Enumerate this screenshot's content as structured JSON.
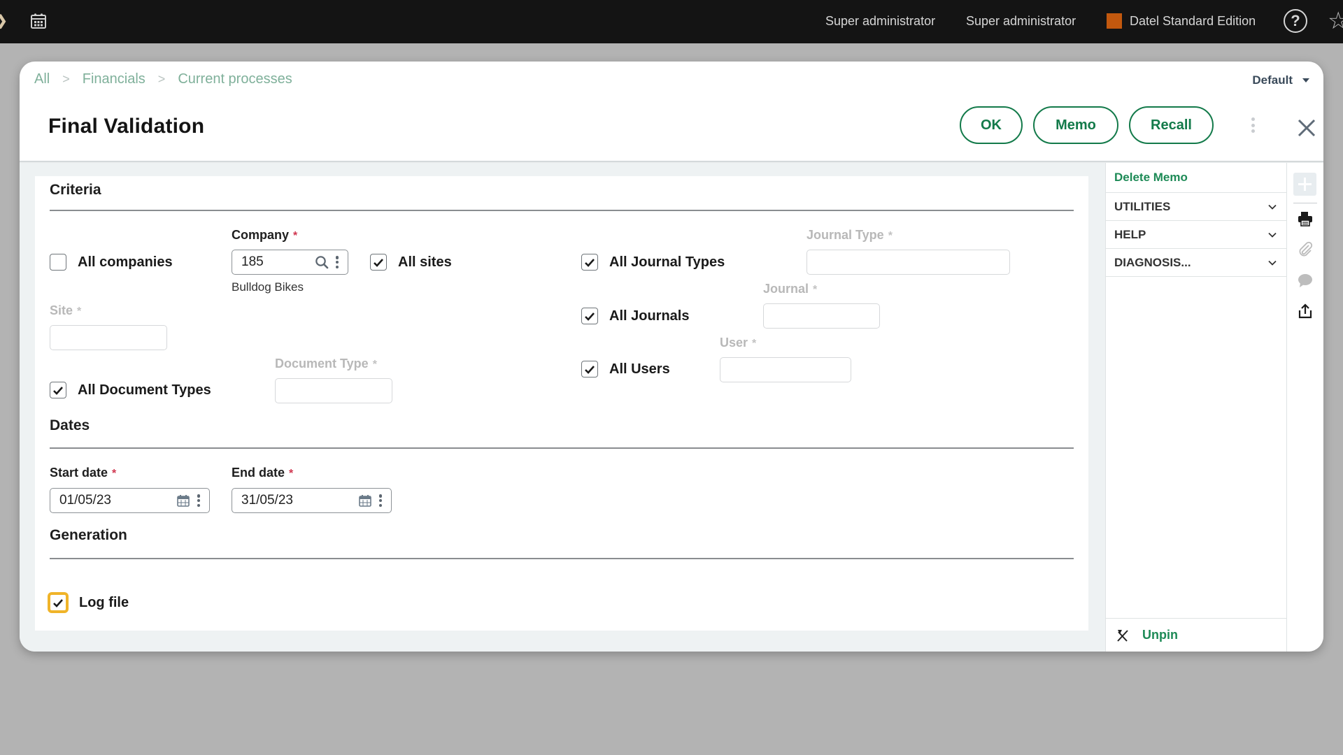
{
  "topbar": {
    "user_role": "Super administrator",
    "user_name": "Super administrator",
    "edition": "Datel Standard Edition",
    "edition_color": "#c2580e",
    "help_glyph": "?",
    "icons": [
      "menu-icon",
      "calendar-icon",
      "help-icon",
      "star-icon"
    ]
  },
  "breadcrumb": {
    "items": [
      "All",
      "Financials",
      "Current processes"
    ],
    "separator": ">"
  },
  "view_selector": {
    "label": "Default"
  },
  "page": {
    "title": "Final Validation",
    "actions": {
      "ok": "OK",
      "memo": "Memo",
      "recall": "Recall"
    }
  },
  "accent_color": "#137a4a",
  "criteria": {
    "title": "Criteria",
    "all_companies": {
      "label": "All companies",
      "checked": false
    },
    "company": {
      "label": "Company",
      "value": "185",
      "description": "Bulldog Bikes",
      "required": true
    },
    "all_sites": {
      "label": "All sites",
      "checked": true
    },
    "site": {
      "label": "Site",
      "value": "",
      "disabled": true
    },
    "all_journal_types": {
      "label": "All Journal Types",
      "checked": true
    },
    "journal_type": {
      "label": "Journal Type",
      "value": "",
      "disabled": true
    },
    "all_journals": {
      "label": "All Journals",
      "checked": true
    },
    "journal": {
      "label": "Journal",
      "value": "",
      "disabled": true
    },
    "all_users": {
      "label": "All Users",
      "checked": true
    },
    "user": {
      "label": "User",
      "value": "",
      "disabled": true
    },
    "all_document_types": {
      "label": "All Document Types",
      "checked": true
    },
    "document_type": {
      "label": "Document Type",
      "value": "",
      "disabled": true
    }
  },
  "dates": {
    "title": "Dates",
    "start_date": {
      "label": "Start date",
      "value": "01/05/23",
      "required": true
    },
    "end_date": {
      "label": "End date",
      "value": "31/05/23",
      "required": true
    }
  },
  "generation": {
    "title": "Generation",
    "log_file": {
      "label": "Log file",
      "checked": true
    }
  },
  "required_mark": "*",
  "side_panel": {
    "delete_memo": "Delete Memo",
    "sections": [
      "UTILITIES",
      "HELP",
      "DIAGNOSIS..."
    ],
    "unpin": "Unpin"
  },
  "rail_icons": [
    "add-icon",
    "print-icon",
    "attachment-icon",
    "comment-icon",
    "share-icon"
  ]
}
